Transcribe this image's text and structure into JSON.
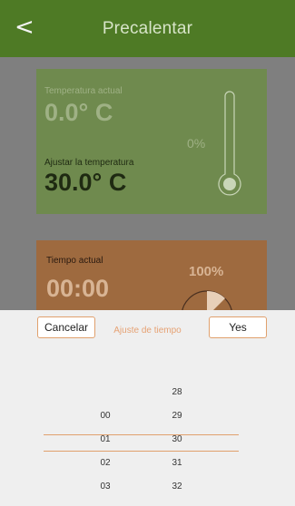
{
  "header": {
    "back_icon": "<",
    "title": "Precalentar"
  },
  "temperature": {
    "current_label": "Temperatura actual",
    "current_value": "0.0° C",
    "percent": "0%",
    "set_label": "Ajustar la temperatura",
    "set_value": "30.0° C"
  },
  "time": {
    "current_label": "Tiempo actual",
    "current_value": "00:00",
    "percent": "100%"
  },
  "picker": {
    "cancel_label": "Cancelar",
    "title": "Ajuste de tiempo",
    "confirm_label": "Yes",
    "column1": [
      "",
      "00",
      "01",
      "02",
      "03"
    ],
    "column2": [
      "28",
      "29",
      "30",
      "31",
      "32"
    ],
    "selected_index": 2
  },
  "colors": {
    "header": "#4e7a25",
    "temp_card": "#6f8a4e",
    "time_card": "#9e6a3f",
    "accent": "#e0a06d"
  }
}
